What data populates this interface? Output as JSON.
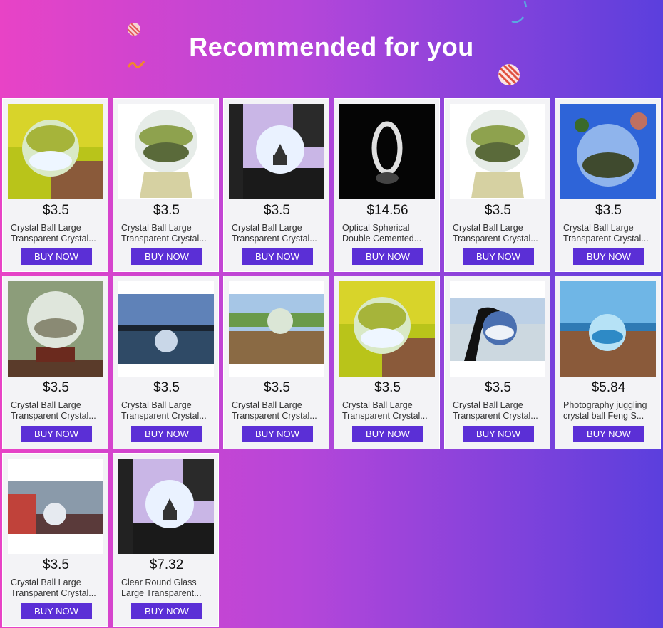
{
  "header": {
    "title": "Recommended for you"
  },
  "products": [
    {
      "price": "$3.5",
      "name1": "Crystal Ball Large",
      "name2": "Transparent Crystal...",
      "button": "BUY NOW",
      "image": "ball-yellow-field"
    },
    {
      "price": "$3.5",
      "name1": "Crystal Ball Large",
      "name2": "Transparent Crystal...",
      "button": "BUY NOW",
      "image": "ball-on-stand"
    },
    {
      "price": "$3.5",
      "name1": "Crystal Ball Large",
      "name2": "Transparent Crystal...",
      "button": "BUY NOW",
      "image": "ball-pagoda-hand"
    },
    {
      "price": "$14.56",
      "name1": "Optical Spherical",
      "name2": "Double Cemented...",
      "button": "BUY NOW",
      "image": "lens-ring-black"
    },
    {
      "price": "$3.5",
      "name1": "Crystal Ball Large",
      "name2": "Transparent Crystal...",
      "button": "BUY NOW",
      "image": "ball-on-stand"
    },
    {
      "price": "$3.5",
      "name1": "Crystal Ball Large",
      "name2": "Transparent Crystal...",
      "button": "BUY NOW",
      "image": "ball-blue-sky"
    },
    {
      "price": "$3.5",
      "name1": "Crystal Ball Large",
      "name2": "Transparent Crystal...",
      "button": "BUY NOW",
      "image": "ball-wood-stand"
    },
    {
      "price": "$3.5",
      "name1": "Crystal Ball Large",
      "name2": "Transparent Crystal...",
      "button": "BUY NOW",
      "image": "ball-lake-sky"
    },
    {
      "price": "$3.5",
      "name1": "Crystal Ball Large",
      "name2": "Transparent Crystal...",
      "button": "BUY NOW",
      "image": "ball-grass-river"
    },
    {
      "price": "$3.5",
      "name1": "Crystal Ball Large",
      "name2": "Transparent Crystal...",
      "button": "BUY NOW",
      "image": "ball-yellow-field"
    },
    {
      "price": "$3.5",
      "name1": "Crystal Ball Large",
      "name2": "Transparent Crystal...",
      "button": "BUY NOW",
      "image": "ball-silhouette-hand"
    },
    {
      "price": "$5.84",
      "name1": "Photography juggling",
      "name2": "crystal ball Feng S...",
      "button": "BUY NOW",
      "image": "ball-beach"
    },
    {
      "price": "$3.5",
      "name1": "Crystal Ball Large",
      "name2": "Transparent Crystal...",
      "button": "BUY NOW",
      "image": "ball-city-street"
    },
    {
      "price": "$7.32",
      "name1": "Clear Round Glass",
      "name2": "Large Transparent...",
      "button": "BUY NOW",
      "image": "ball-pagoda-hand"
    }
  ],
  "colors": {
    "accent": "#5b2fd6",
    "bg_left": "#e843c6",
    "bg_right": "#5b3fdd"
  }
}
